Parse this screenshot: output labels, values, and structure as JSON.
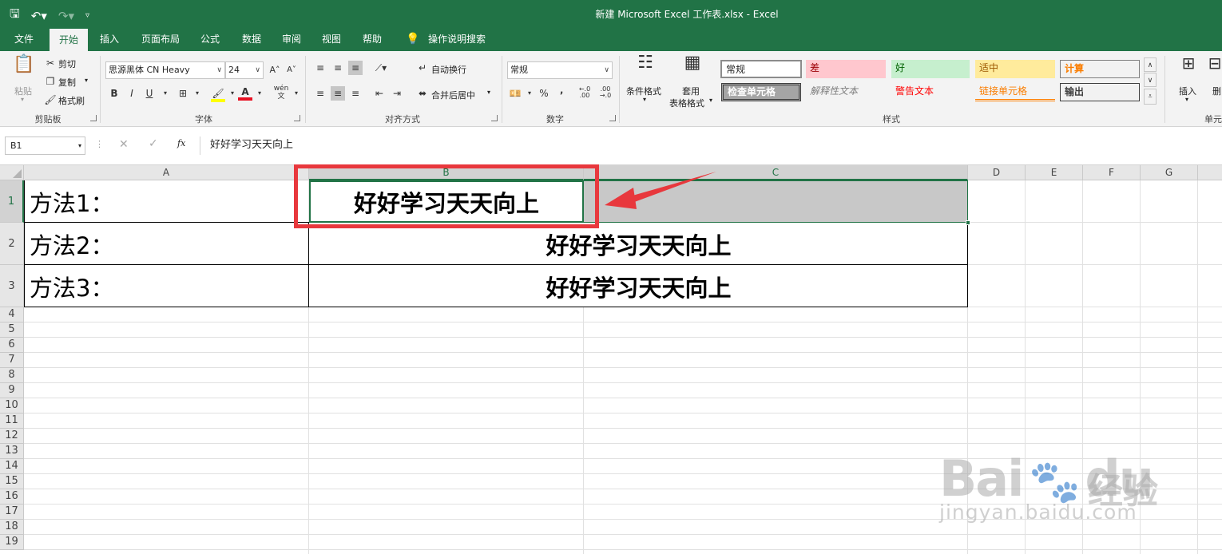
{
  "window": {
    "title": "新建 Microsoft Excel 工作表.xlsx  -  Excel"
  },
  "ribbon_tabs": [
    "文件",
    "开始",
    "插入",
    "页面布局",
    "公式",
    "数据",
    "审阅",
    "视图",
    "帮助",
    "操作说明搜索"
  ],
  "clipboard": {
    "paste": "粘贴",
    "cut": "剪切",
    "copy": "复制",
    "format_painter": "格式刷",
    "label": "剪贴板"
  },
  "font": {
    "name": "思源黑体 CN Heavy",
    "size": "24",
    "bold": "B",
    "italic": "I",
    "underline": "U",
    "phonetic": "wén",
    "label": "字体"
  },
  "alignment": {
    "wrap_text": "自动换行",
    "merge_center": "合并后居中",
    "label": "对齐方式"
  },
  "number": {
    "format": "常规",
    "percent": "%",
    "comma": "9",
    "label": "数字"
  },
  "styles": {
    "conditional_formatting": "条件格式",
    "format_as_table_1": "套用",
    "format_as_table_2": "表格格式",
    "cells": [
      {
        "label": "常规"
      },
      {
        "label": "差"
      },
      {
        "label": "好"
      },
      {
        "label": "适中"
      },
      {
        "label": "计算"
      },
      {
        "label": "检查单元格"
      },
      {
        "label": "解释性文本"
      },
      {
        "label": "警告文本"
      },
      {
        "label": "链接单元格"
      },
      {
        "label": "输出"
      }
    ],
    "label": "样式"
  },
  "cells_group": {
    "insert": "插入",
    "delete": "删",
    "label": "单元"
  },
  "formula_bar": {
    "name_box": "B1",
    "fx": "fx",
    "formula": "好好学习天天向上"
  },
  "columns": [
    "A",
    "B",
    "C",
    "D",
    "E",
    "F",
    "G"
  ],
  "rows": [
    "1",
    "2",
    "3",
    "4",
    "5",
    "6",
    "7",
    "8",
    "9",
    "10",
    "11",
    "12",
    "13",
    "14",
    "15",
    "16",
    "17",
    "18",
    "19"
  ],
  "sheet": {
    "a1": "方法1：",
    "a2": "方法2：",
    "a3": "方法3：",
    "b1": "好好学习天天向上",
    "b2": "好好学习天天向上",
    "b3": "好好学习天天向上"
  },
  "watermark": {
    "brand": "Bai",
    "brand_suffix": "du",
    "product": "经验",
    "url": "jingyan.baidu.com"
  },
  "colors": {
    "excel_green": "#217346",
    "annotation_red": "#e8383d",
    "selection_gray": "#c8c8c8"
  }
}
